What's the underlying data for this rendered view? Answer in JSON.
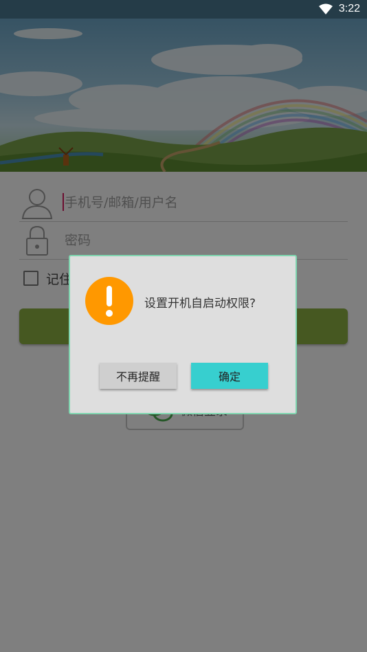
{
  "status_bar": {
    "time": "3:22",
    "wifi_icon": "wifi-icon"
  },
  "login": {
    "username_placeholder": "手机号/邮箱/用户名",
    "password_placeholder": "密码",
    "remember_label": "记住",
    "wechat_label": "微信登录"
  },
  "dialog": {
    "message": "设置开机自启动权限?",
    "dismiss_label": "不再提醒",
    "confirm_label": "确定",
    "icon": "warning-icon"
  },
  "colors": {
    "accent_green": "#8cb043",
    "confirm_cyan": "#37cfcf",
    "warning_orange": "#ff9800",
    "dialog_border": "#7fd6b0"
  }
}
